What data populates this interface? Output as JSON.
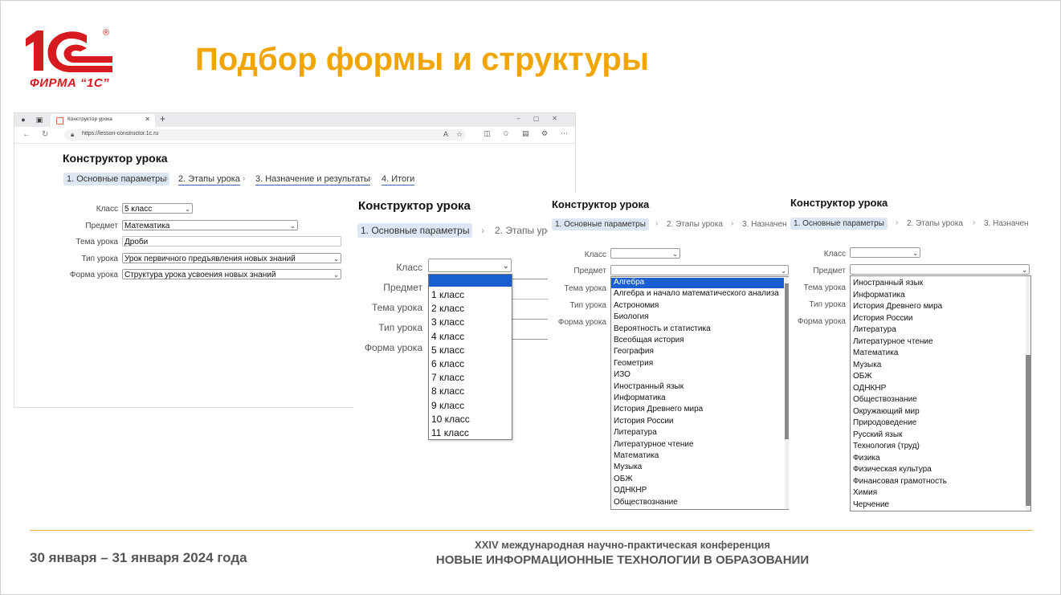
{
  "slide": {
    "title": "Подбор формы и структуры",
    "logo_text": "ФИРМА “1С”",
    "logo_mark": "1С",
    "registered": "®"
  },
  "footer": {
    "date": "30 января – 31 января 2024 года",
    "conf_line1": "XXIV международная научно-практическая конференция",
    "conf_line2": "НОВЫЕ ИНФОРМАЦИОННЫЕ ТЕХНОЛОГИИ В ОБРАЗОВАНИИ"
  },
  "browser": {
    "tab_title": "Конструктор урока",
    "url": "https://lesson-constructor.1c.ru",
    "new_tab": "+",
    "close": "✕"
  },
  "app": {
    "title": "Конструктор урока",
    "steps": [
      "1. Основные параметры",
      "2. Этапы урока",
      "3. Назначение и результаты",
      "4. Итоги"
    ],
    "fields": {
      "class_label": "Класс",
      "subject_label": "Предмет",
      "topic_label": "Тема урока",
      "type_label": "Тип урока",
      "form_label": "Форма урока",
      "class_value": "5 класс",
      "subject_value": "Математика",
      "topic_value": "Дроби",
      "type_value": "Урок первичного предъявления новых знаний",
      "form_value": "Структура урока усвоения новых знаний"
    }
  },
  "panel2": {
    "title": "Конструктор урока",
    "step1": "1. Основные параметры",
    "step2": "2. Этапы уро",
    "class_options": [
      "1 класс",
      "2 класс",
      "3 класс",
      "4 класс",
      "5 класс",
      "6 класс",
      "7 класс",
      "8 класс",
      "9 класс",
      "10 класс",
      "11 класс"
    ]
  },
  "panel3": {
    "title": "Конструктор урока",
    "step1": "1. Основные параметры",
    "step2": "2. Этапы урока",
    "step3": "3. Назначен",
    "subjects": [
      "Алгебра",
      "Алгебра и начало математического анализа",
      "Астрономия",
      "Биология",
      "Вероятность и статистика",
      "Всеобщая история",
      "География",
      "Геометрия",
      "ИЗО",
      "Иностранный язык",
      "Информатика",
      "История Древнего мира",
      "История России",
      "Литература",
      "Литературное чтение",
      "Математика",
      "Музыка",
      "ОБЖ",
      "ОДНКНР",
      "Обществознание"
    ],
    "scroll_position": 0.0
  },
  "panel4": {
    "title": "Конструктор урока",
    "step1": "1. Основные параметры",
    "step2": "2. Этапы урока",
    "step3": "3. Назначен",
    "subjects": [
      "Иностранный язык",
      "Информатика",
      "История Древнего мира",
      "История России",
      "Литература",
      "Литературное чтение",
      "Математика",
      "Музыка",
      "ОБЖ",
      "ОДНКНР",
      "Обществознание",
      "Окружающий мир",
      "Природоведение",
      "Русский язык",
      "Технология (труд)",
      "Физика",
      "Физическая культура",
      "Финансовая грамотность",
      "Химия",
      "Черчение"
    ],
    "scroll_position": 1.0
  },
  "colors": {
    "accent": "#f0a500",
    "brand": "#d61a1f",
    "selection": "#1a5fd0"
  }
}
